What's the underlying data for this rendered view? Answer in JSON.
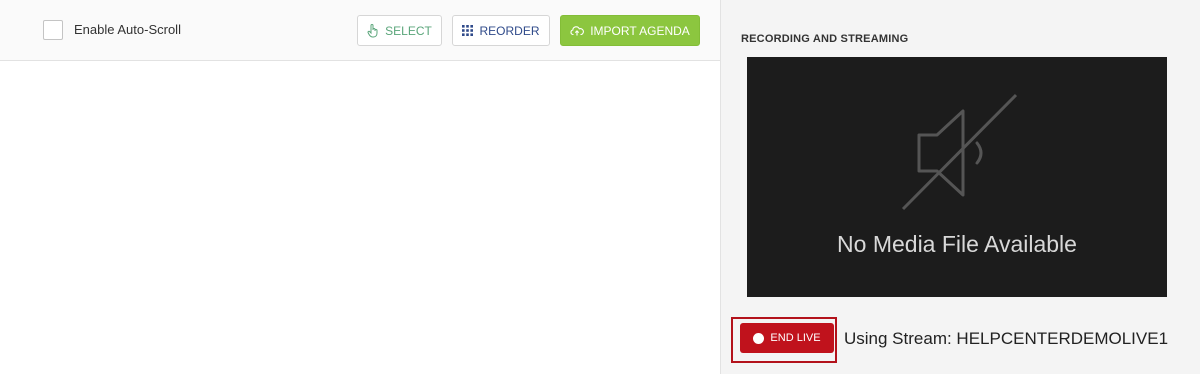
{
  "toolbar": {
    "auto_scroll_label": "Enable Auto-Scroll",
    "auto_scroll_checked": false,
    "select_label": "SELECT",
    "reorder_label": "REORDER",
    "import_label": "IMPORT AGENDA"
  },
  "recording": {
    "section_title": "RECORDING AND STREAMING",
    "no_media_text": "No Media File Available",
    "end_live_label": "END LIVE",
    "stream_text": "Using Stream: HELPCENTERDEMOLIVE1"
  },
  "icons": {
    "select": "hand-pointer-icon",
    "reorder": "grid-dots-icon",
    "import": "cloud-upload-icon",
    "media": "muted-speaker-icon",
    "end_live": "record-dot-icon"
  },
  "colors": {
    "import_button": "#8cc63f",
    "end_live_button": "#c0121c",
    "highlight_outline": "#b3121b",
    "media_background": "#1c1c1c"
  }
}
